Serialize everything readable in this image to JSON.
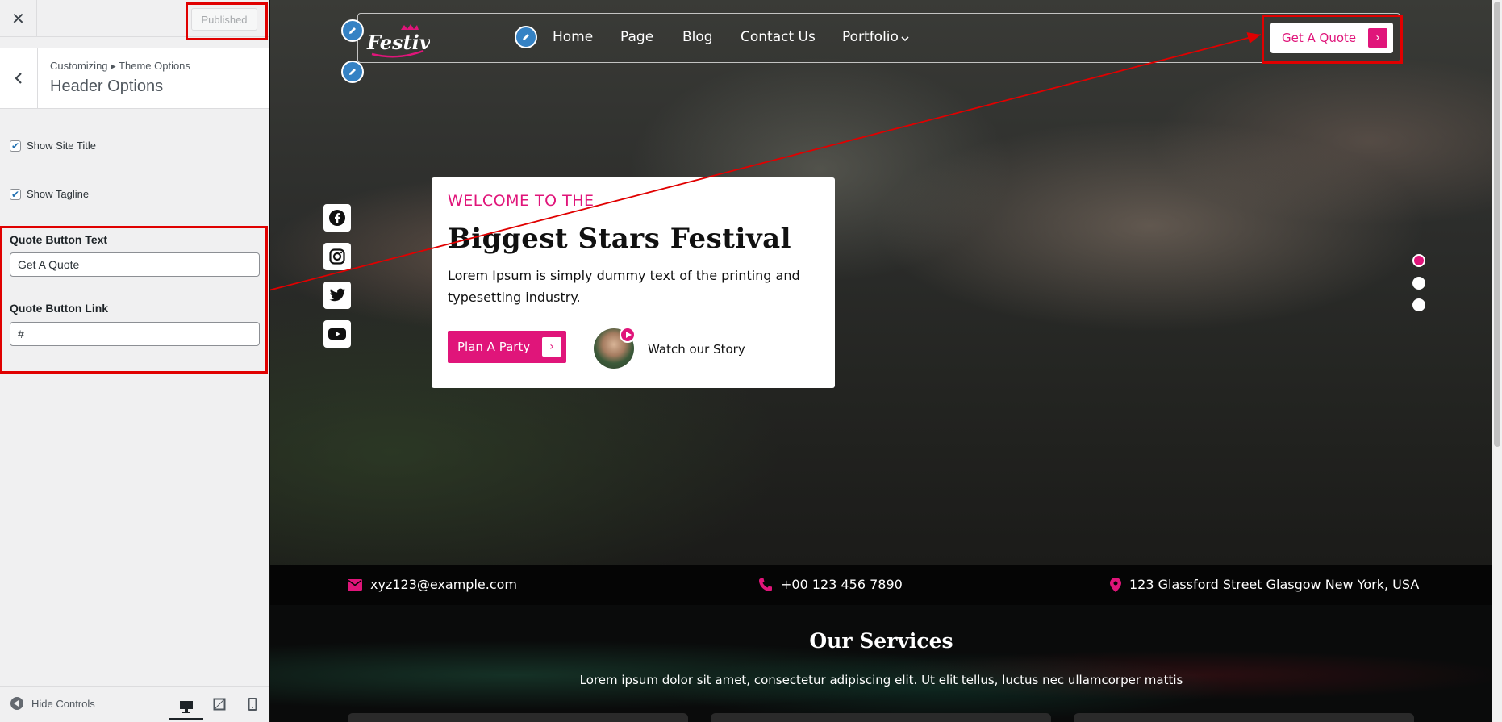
{
  "customizer": {
    "publish_label": "Published",
    "breadcrumb": "Customizing ▸ Theme Options",
    "section_title": "Header Options",
    "show_site_title_label": "Show Site Title",
    "show_tagline_label": "Show Tagline",
    "show_site_title_checked": true,
    "show_tagline_checked": true,
    "quote_text_label": "Quote Button Text",
    "quote_text_value": "Get A Quote",
    "quote_link_label": "Quote Button Link",
    "quote_link_value": "#",
    "hide_controls_label": "Hide Controls",
    "devices": [
      "desktop-icon",
      "tablet-icon",
      "mobile-icon"
    ]
  },
  "site": {
    "logo_text": "Festival",
    "nav": [
      "Home",
      "Page",
      "Blog",
      "Contact Us",
      "Portfolio"
    ],
    "quote_button": "Get A Quote",
    "social": [
      "facebook-icon",
      "instagram-icon",
      "twitter-icon",
      "youtube-icon"
    ],
    "hero": {
      "kicker": "WELCOME TO THE",
      "title": "Biggest Stars Festival",
      "description": "Lorem Ipsum is simply dummy text of the printing and typesetting industry.",
      "cta": "Plan A Party",
      "watch": "Watch our Story"
    },
    "contact": {
      "email": "xyz123@example.com",
      "phone": "+00 123 456 7890",
      "address": "123 Glassford Street Glasgow New York, USA"
    },
    "services": {
      "title": "Our Services",
      "description": "Lorem ipsum dolor sit amet, consectetur adipiscing elit. Ut elit tellus, luctus nec ullamcorper mattis"
    }
  },
  "colors": {
    "accent": "#e0157a",
    "annotation": "#e00000",
    "wp_blue": "#3582c4"
  }
}
